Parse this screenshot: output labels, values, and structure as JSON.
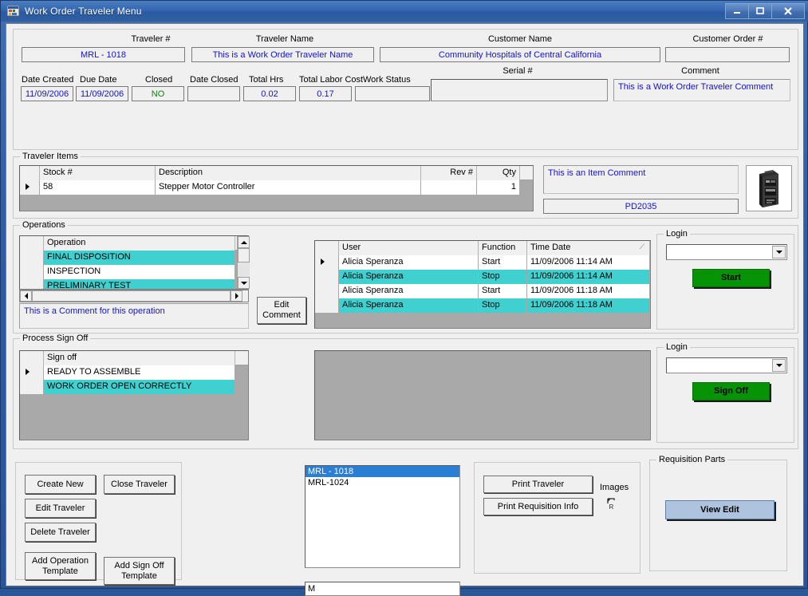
{
  "window": {
    "title": "Work Order Traveler Menu",
    "icon": "app-form-icon",
    "minimize": "–",
    "maximize": "□",
    "close": "✕"
  },
  "header": {
    "traveler_no_label": "Traveler #",
    "traveler_no_value": "MRL - 1018",
    "traveler_name_label": "Traveler Name",
    "traveler_name_value": "This is a Work Order Traveler Name",
    "customer_name_label": "Customer Name",
    "customer_name_value": "Community Hospitals of Central California",
    "customer_order_label": "Customer Order #",
    "customer_order_value": "",
    "date_created_label": "Date Created",
    "date_created_value": "11/09/2006",
    "due_date_label": "Due Date",
    "due_date_value": "11/09/2006",
    "closed_label": "Closed",
    "closed_value": "NO",
    "date_closed_label": "Date Closed",
    "date_closed_value": "",
    "total_hrs_label": "Total Hrs",
    "total_hrs_value": "0.02",
    "total_labor_cost_label": "Total Labor Cost",
    "total_labor_cost_value": "0.17",
    "work_status_label": "Work Status",
    "work_status_value": "",
    "serial_label": "Serial #",
    "serial_value": "",
    "comment_label": "Comment",
    "comment_value": "This is a Work Order Traveler Comment"
  },
  "traveler_items": {
    "group_title": "Traveler Items",
    "columns": [
      "",
      "Stock #",
      "Description",
      "Rev #",
      "Qty"
    ],
    "rows": [
      {
        "marker": "▶",
        "stock": "58",
        "description": "Stepper Motor Controller",
        "rev": "",
        "qty": "1"
      }
    ],
    "item_comment": "This is an Item Comment",
    "part_number": "PD2035",
    "image_alt": "stepper-motor-controller-photo"
  },
  "operations": {
    "group_title": "Operations",
    "column_header": "Operation",
    "rows": [
      {
        "label": "FINAL DISPOSITION",
        "selected": true
      },
      {
        "label": "INSPECTION",
        "selected": false
      },
      {
        "label": "PRELIMINARY TEST",
        "selected": true
      }
    ],
    "operation_comment": "This is a Comment for this operation",
    "edit_comment_button": "Edit\nComment",
    "edit_comment_line1": "Edit",
    "edit_comment_line2": "Comment",
    "log_columns": [
      "",
      "User",
      "Function",
      "Time Date"
    ],
    "log_sort_glyph": "⟋",
    "log_rows": [
      {
        "marker": "▶",
        "user": "Alicia Speranza",
        "function": "Start",
        "time_date": "11/09/2006 11:14 AM",
        "selected": false
      },
      {
        "marker": "",
        "user": "Alicia Speranza",
        "function": "Stop",
        "time_date": "11/09/2006 11:14 AM",
        "selected": true
      },
      {
        "marker": "",
        "user": "Alicia Speranza",
        "function": "Start",
        "time_date": "11/09/2006 11:18 AM",
        "selected": false
      },
      {
        "marker": "",
        "user": "Alicia Speranza",
        "function": "Stop",
        "time_date": "11/09/2006 11:18 AM",
        "selected": true
      }
    ],
    "login_group_title": "Login",
    "login_value": "",
    "start_button": "Start"
  },
  "process_sign_off": {
    "group_title": "Process Sign Off",
    "column_header": "Sign off",
    "rows": [
      {
        "marker": "▶",
        "label": "READY TO ASSEMBLE",
        "selected": false
      },
      {
        "marker": "",
        "label": "WORK ORDER OPEN CORRECTLY",
        "selected": true
      }
    ],
    "login_group_title": "Login",
    "login_value": "",
    "sign_off_button": "Sign Off"
  },
  "actions": {
    "create_new": "Create New",
    "close_traveler": "Close Traveler",
    "edit_traveler": "Edit Traveler",
    "delete_traveler": "Delete Traveler",
    "add_operation_template_line1": "Add Operation",
    "add_operation_template_line2": "Template",
    "add_sign_off_template_line1": "Add Sign Off",
    "add_sign_off_template_line2": "Template"
  },
  "traveler_list": {
    "items": [
      {
        "label": "MRL - 1018",
        "selected": true
      },
      {
        "label": "MRL-1024",
        "selected": false
      }
    ],
    "search_value": "M"
  },
  "print_panel": {
    "print_traveler": "Print Traveler",
    "print_requisition_info": "Print Requisition Info",
    "images_label": "Images",
    "images_icon": "broken-image-icon"
  },
  "requisition": {
    "group_title": "Requisition Parts",
    "view_edit_button": "View Edit"
  },
  "colors": {
    "selection_teal": "#40d0d0",
    "list_selection_blue": "#2a7fd4",
    "button_green": "#069306",
    "button_blue": "#aec3de",
    "field_text_blue": "#1414c8",
    "status_green": "#108010",
    "grid_back": "#a9a9a9",
    "form_back": "#f0f0f0",
    "titlebar_blue": "#3467b0"
  }
}
